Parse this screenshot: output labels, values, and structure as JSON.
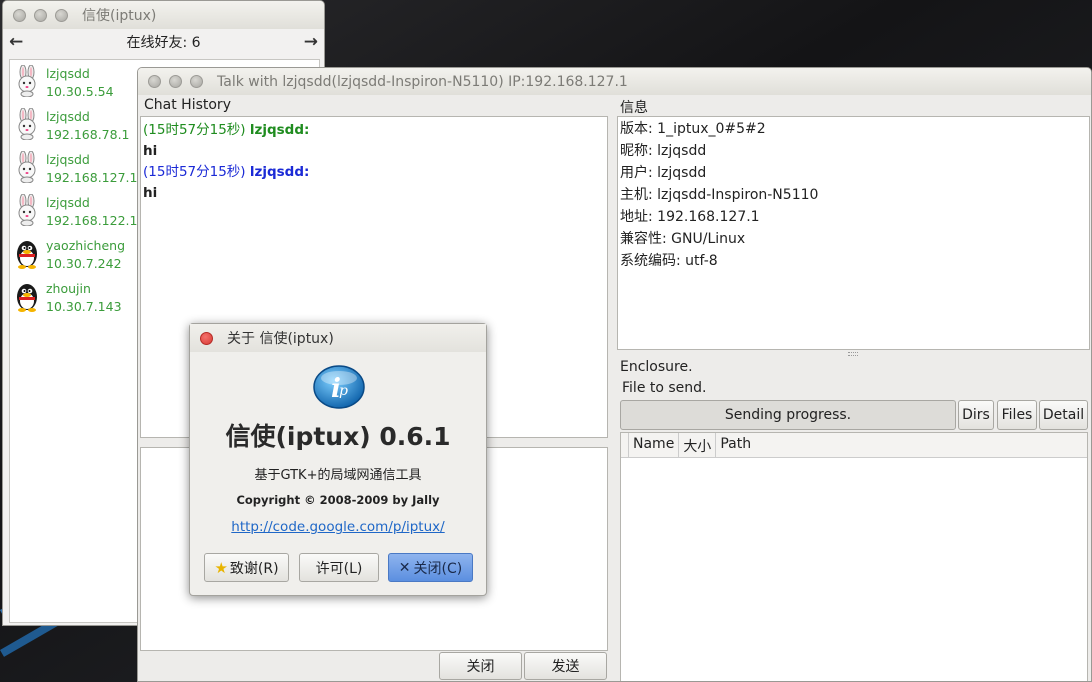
{
  "friends_window": {
    "title": "信使(iptux)",
    "online_label": "在线好友: 6",
    "prev_arrow": "←",
    "next_arrow": "→",
    "friends": [
      {
        "name": "lzjqsdd",
        "ip": "10.30.5.54",
        "avatar": "rabbit-avatar"
      },
      {
        "name": "lzjqsdd",
        "ip": "192.168.78.1",
        "avatar": "rabbit-avatar"
      },
      {
        "name": "lzjqsdd",
        "ip": "192.168.127.1",
        "avatar": "rabbit-avatar"
      },
      {
        "name": "lzjqsdd",
        "ip": "192.168.122.1",
        "avatar": "rabbit-avatar"
      },
      {
        "name": "yaozhicheng",
        "ip": "10.30.7.242",
        "avatar": "penguin-avatar"
      },
      {
        "name": "zhoujin",
        "ip": "10.30.7.143",
        "avatar": "penguin-avatar"
      }
    ]
  },
  "talk_window": {
    "title": "Talk with lzjqsdd(lzjqsdd-Inspiron-N5110) IP:192.168.127.1",
    "chat_history_label": "Chat History",
    "messages": [
      {
        "time": "(15时57分15秒)",
        "sender": "lzjqsdd:",
        "text": "hi",
        "color": "#1f8c1f"
      },
      {
        "time": "(15时57分15秒)",
        "sender": "lzjqsdd:",
        "text": "hi",
        "color": "#1b2ad6"
      }
    ],
    "close_button": "关闭",
    "send_button": "发送",
    "info_label": "信息",
    "info": {
      "version": "版本: 1_iptux_0#5#2",
      "nickname": "昵称: lzjqsdd",
      "user": "用户: lzjqsdd",
      "host": "主机: lzjqsdd-Inspiron-N5110",
      "address": "地址: 192.168.127.1",
      "compat": "兼容性: GNU/Linux",
      "encoding": "系统编码: utf-8"
    },
    "enclosure_label": "Enclosure.",
    "file_to_send_label": "File to send.",
    "sending_progress": "Sending progress.",
    "dirs_button": "Dirs",
    "files_button": "Files",
    "detail_button": "Detail",
    "columns": [
      "Name",
      "大小",
      "Path"
    ]
  },
  "about_dialog": {
    "title": "关于 信使(iptux)",
    "app_name": "信使(iptux) 0.6.1",
    "description": "基于GTK+的局域网通信工具",
    "copyright": "Copyright © 2008-2009 by Jally",
    "link": "http://code.google.com/p/iptux/",
    "credits_button": "致谢(R)",
    "license_button": "许可(L)",
    "close_button": "关闭(C)",
    "close_symbol": "✕",
    "star_symbol": "★"
  }
}
